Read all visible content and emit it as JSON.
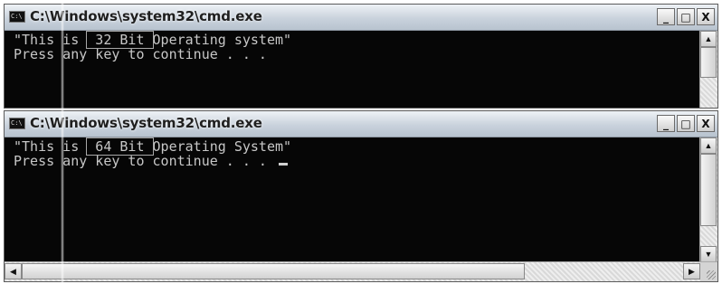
{
  "windows": [
    {
      "title": "C:\\Windows\\system32\\cmd.exe",
      "app_icon_text": "C:\\",
      "controls": {
        "minimize": "_",
        "maximize": "□",
        "close": "X"
      },
      "console": {
        "line1_pre": "\"This is ",
        "line1_boxed": " 32 Bit ",
        "line1_post": "Operating system\"",
        "line2": "Press any key to continue . . ."
      }
    },
    {
      "title": "C:\\Windows\\system32\\cmd.exe",
      "app_icon_text": "C:\\",
      "controls": {
        "minimize": "_",
        "maximize": "□",
        "close": "X"
      },
      "console": {
        "line1_pre": "\"This is ",
        "line1_boxed": " 64 Bit ",
        "line1_post": "Operating System\"",
        "line2": "Press any key to continue . . . "
      }
    }
  ],
  "scroll_glyphs": {
    "up": "▲",
    "down": "▼",
    "left": "◀",
    "right": "▶"
  },
  "colors": {
    "console_bg": "#060606",
    "console_fg": "#c7c7c7",
    "titlebar": "#c9d2dc"
  }
}
